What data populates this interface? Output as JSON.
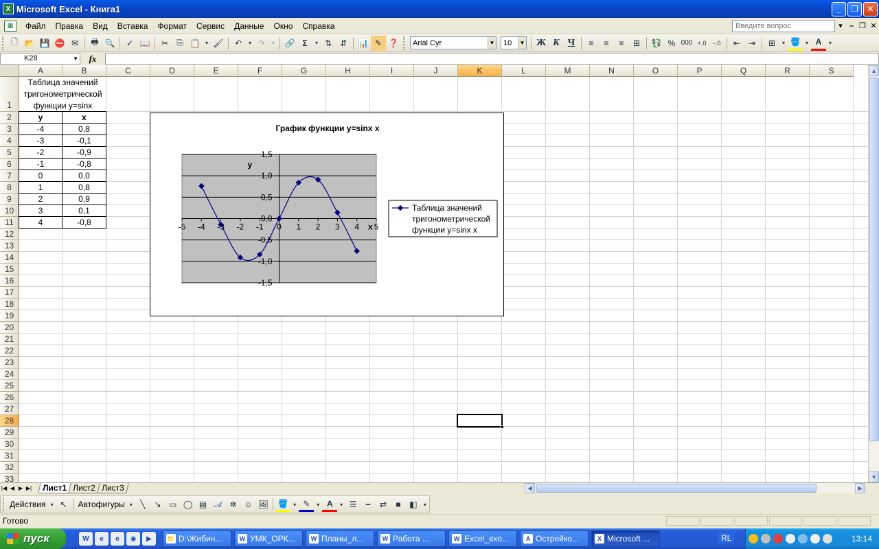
{
  "window": {
    "title": "Microsoft Excel - Книга1"
  },
  "menu": {
    "items": [
      "Файл",
      "Правка",
      "Вид",
      "Вставка",
      "Формат",
      "Сервис",
      "Данные",
      "Окно",
      "Справка"
    ],
    "help_placeholder": "Введите вопрос"
  },
  "toolbar": {
    "font_name": "Arial Cyr",
    "font_size": "10",
    "bold": "Ж",
    "italic": "К",
    "underline": "Ч",
    "percent": "%",
    "thousands": "000"
  },
  "formula_bar": {
    "name_box": "K28",
    "fx": "fx"
  },
  "columns": [
    "A",
    "B",
    "C",
    "D",
    "E",
    "F",
    "G",
    "H",
    "I",
    "J",
    "K",
    "L",
    "M",
    "N",
    "O",
    "P",
    "Q",
    "R",
    "S"
  ],
  "active_column": "K",
  "active_row": "28",
  "rows": [
    "1",
    "2",
    "3",
    "4",
    "5",
    "6",
    "7",
    "8",
    "9",
    "10",
    "11",
    "12",
    "13",
    "14",
    "15",
    "16",
    "17",
    "18",
    "19",
    "20",
    "21",
    "22",
    "23",
    "24",
    "25",
    "26",
    "27",
    "28",
    "29",
    "30",
    "31",
    "32",
    "33"
  ],
  "sheet": {
    "a1_title": "Таблица значений тригонометрической функции y=sinx",
    "header_a": "y",
    "header_b": "x",
    "table": [
      [
        "-4",
        "0,8"
      ],
      [
        "-3",
        "-0,1"
      ],
      [
        "-2",
        "-0,9"
      ],
      [
        "-1",
        "-0,8"
      ],
      [
        "0",
        "0,0"
      ],
      [
        "1",
        "0,8"
      ],
      [
        "2",
        "0,9"
      ],
      [
        "3",
        "0,1"
      ],
      [
        "4",
        "-0,8"
      ]
    ]
  },
  "chart_data": {
    "type": "scatter",
    "title": "График функции y=sinx x",
    "xlabel": "x",
    "ylabel": "y",
    "xlim": [
      -5,
      5
    ],
    "ylim": [
      -1.5,
      1.5
    ],
    "x_ticks": [
      "-5",
      "-4",
      "-3",
      "-2",
      "-1",
      "0",
      "1",
      "2",
      "3",
      "4",
      "5"
    ],
    "y_ticks": [
      "1,5",
      "1,0",
      "0,5",
      "0,0",
      "-0,5",
      "-1,0",
      "-1,5"
    ],
    "grid": true,
    "legend_position": "right",
    "series": [
      {
        "name": "Таблица значений тригонометрической функции y=sinx x",
        "x": [
          -4,
          -3,
          -2,
          -1,
          0,
          1,
          2,
          3,
          4
        ],
        "y": [
          0.76,
          -0.14,
          -0.91,
          -0.84,
          0.0,
          0.84,
          0.91,
          0.14,
          -0.76
        ],
        "color": "#000080"
      }
    ],
    "plot_background": "#c0c0c0"
  },
  "sheet_tabs": [
    "Лист1",
    "Лист2",
    "Лист3"
  ],
  "active_sheet": "Лист1",
  "drawing_toolbar": {
    "actions": "Действия",
    "autoshapes": "Автофигуры"
  },
  "status": {
    "text": "Готово"
  },
  "taskbar": {
    "start": "пуск",
    "tasks": [
      "D:\\Жибин...",
      "УМК_ОРК...",
      "Планы_л...",
      "Работа ...",
      "Excel_вхо...",
      "Острейко...",
      "Microsoft ..."
    ],
    "active_task": 6,
    "lang": "RL",
    "clock": "13:14"
  },
  "colors": {
    "title_bar": "#0a5ae8",
    "active_header": "#f4b048",
    "series": "#000080",
    "plot_area": "#c0c0c0"
  }
}
